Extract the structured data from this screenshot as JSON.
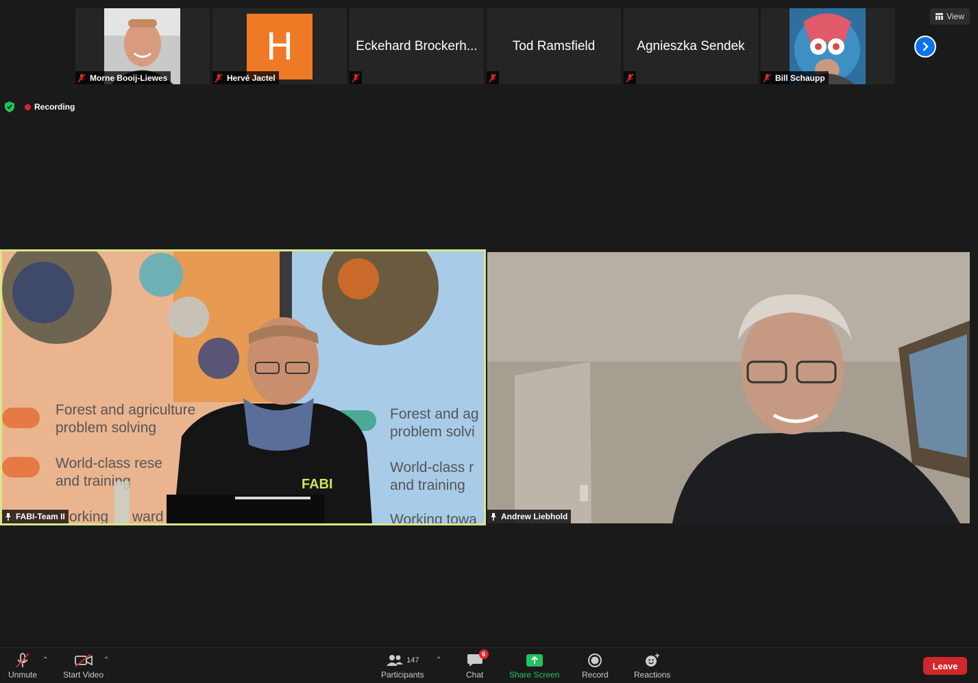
{
  "strip": {
    "tiles": [
      {
        "name": "Morne Booij-Liewes"
      },
      {
        "name": "Hervé Jactel",
        "avatar_letter": "H"
      },
      {
        "name": "Eckehard Brockerh..."
      },
      {
        "name": "Tod Ramsfield"
      },
      {
        "name": "Agnieszka Sendek"
      },
      {
        "name": "Bill Schaupp"
      }
    ]
  },
  "view_button": {
    "label": "View"
  },
  "recording": {
    "label": "Recording"
  },
  "videos": {
    "left": {
      "label": "FABI-Team II",
      "banner_lines": [
        "Forest and agriculture",
        "problem solving",
        "World-class rese",
        "and training",
        "orking",
        "ward"
      ],
      "banner_lines_right": [
        "Forest and ag",
        "problem solvi",
        "World-class r",
        "and training",
        "Working towa"
      ],
      "shirt_logo": "FABI"
    },
    "right": {
      "label": "Andrew Liebhold"
    }
  },
  "toolbar": {
    "unmute": "Unmute",
    "start_video": "Start Video",
    "participants": "Participants",
    "participants_count": "147",
    "chat": "Chat",
    "chat_badge": "6",
    "share_screen": "Share Screen",
    "record": "Record",
    "reactions": "Reactions",
    "leave": "Leave"
  },
  "colors": {
    "active_speaker_border": "#d8e88a",
    "share_green": "#22c35e",
    "leave_red": "#d1262b",
    "next_blue": "#0e72ed",
    "avatar_orange": "#ee7a26"
  }
}
